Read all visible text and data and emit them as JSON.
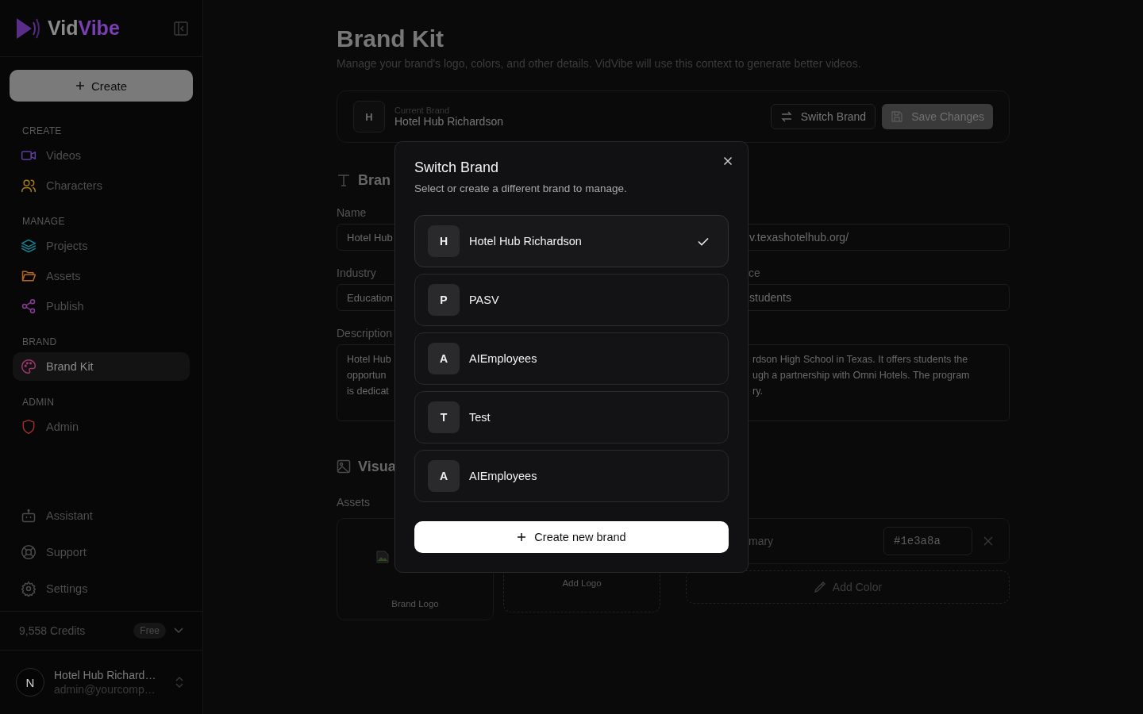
{
  "sidebar": {
    "logo_parts": [
      "Vid",
      "Vibe"
    ],
    "create_button": "Create",
    "sections": [
      {
        "heading": "CREATE",
        "items": [
          {
            "label": "Videos",
            "kind": "video",
            "color": "#5e3fa0",
            "selected": false
          },
          {
            "label": "Characters",
            "kind": "users",
            "color": "#a67a14",
            "selected": false
          }
        ]
      },
      {
        "heading": "MANAGE",
        "items": [
          {
            "label": "Projects",
            "kind": "layers",
            "color": "#137f8f",
            "selected": false
          },
          {
            "label": "Assets",
            "kind": "folder",
            "color": "#b3661a",
            "selected": false
          },
          {
            "label": "Publish",
            "kind": "share",
            "color": "#8a3a98",
            "selected": false
          }
        ]
      },
      {
        "heading": "BRAND",
        "items": [
          {
            "label": "Brand Kit",
            "kind": "palette",
            "color": "#a0356e",
            "selected": true
          }
        ]
      },
      {
        "heading": "ADMIN",
        "items": [
          {
            "label": "Admin",
            "kind": "shield",
            "color": "#9e2e2e",
            "selected": false
          }
        ]
      }
    ],
    "bottom_items": [
      {
        "label": "Assistant",
        "kind": "bot"
      },
      {
        "label": "Support",
        "kind": "lifebuoy"
      },
      {
        "label": "Settings",
        "kind": "gear"
      }
    ],
    "credits": "9,558 Credits",
    "plan": "Free",
    "user": {
      "initial": "N",
      "name": "Hotel Hub Richard…",
      "email": "admin@yourcomp…"
    }
  },
  "page": {
    "title": "Brand Kit",
    "subtitle": "Manage your brand's logo, colors, and other details. VidVibe will use this context to generate better videos.",
    "current_brand": {
      "initial": "H",
      "label": "Current Brand",
      "name": "Hotel Hub Richardson"
    },
    "switch_button": "Switch Brand",
    "save_button": "Save Changes",
    "details_heading": "Bran",
    "name": {
      "label": "Name",
      "value": "Hotel Hub"
    },
    "website": {
      "value": "v.texashotelhub.org/"
    },
    "industry": {
      "label": "Industry",
      "value": "Education"
    },
    "audience": {
      "label": "ce",
      "value": "students"
    },
    "description": {
      "label": "Description",
      "left_lines": [
        "Hotel Hub",
        "opportun",
        "is dedicat"
      ],
      "right_lines": [
        "rdson High School in Texas. It offers students the",
        "ugh a partnership with Omni Hotels. The program",
        "ry."
      ]
    },
    "visual_heading": "Visua",
    "assets_label": "Assets",
    "logo_caption": "Brand Logo",
    "add_logo": "Add Logo",
    "color": {
      "label": "mary",
      "value": "#1e3a8a"
    },
    "add_color": "Add Color"
  },
  "modal": {
    "title": "Switch Brand",
    "subtitle": "Select or create a different brand to manage.",
    "brands": [
      {
        "initial": "H",
        "name": "Hotel Hub Richardson",
        "selected": true
      },
      {
        "initial": "P",
        "name": "PASV",
        "selected": false
      },
      {
        "initial": "A",
        "name": "AIEmployees",
        "selected": false
      },
      {
        "initial": "T",
        "name": "Test",
        "selected": false
      },
      {
        "initial": "A",
        "name": "AIEmployees",
        "selected": false
      }
    ],
    "create_button": "Create new brand"
  }
}
